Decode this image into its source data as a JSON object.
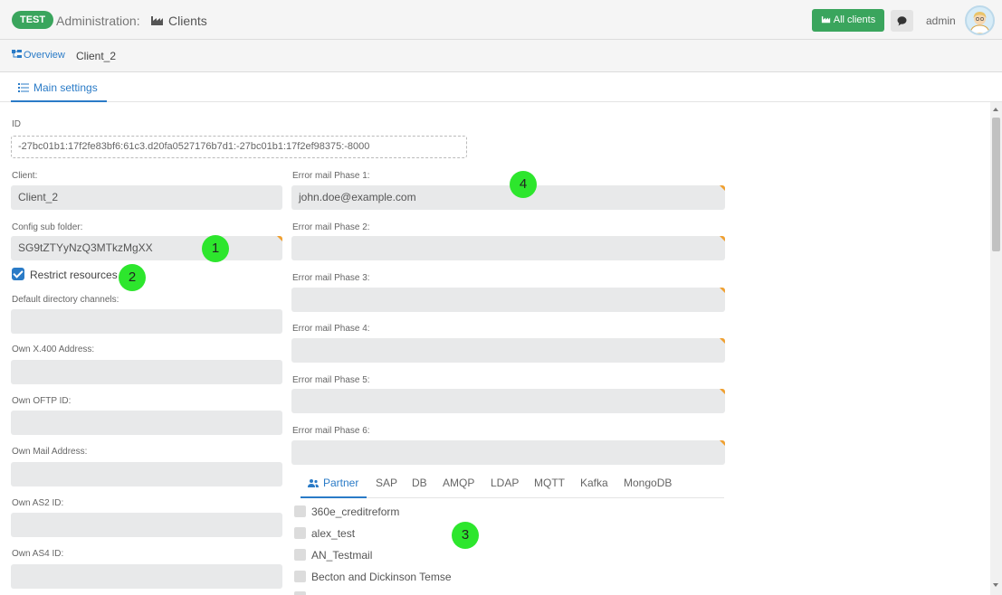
{
  "header": {
    "env_badge": "TEST",
    "title": "Administration:",
    "section": "Clients",
    "all_clients_label": "All clients",
    "user": "admin"
  },
  "breadcrumb": {
    "overview": "Overview",
    "current": "Client_2"
  },
  "tabs": {
    "main_settings": "Main settings"
  },
  "form": {
    "id_label": "ID",
    "id_value": "-27bc01b1:17f2fe83bf6:61c3.d20fa0527176b7d1:-27bc01b1:17f2ef98375:-8000",
    "client_label": "Client:",
    "client_value": "Client_2",
    "config_sub_folder_label": "Config sub folder:",
    "config_sub_folder_value": "SG9tZTYyNzQ3MTkzMgXX",
    "restrict_resources_label": "Restrict resources",
    "restrict_resources_checked": true,
    "default_directory_channels_label": "Default directory channels:",
    "own_x400_label": "Own X.400 Address:",
    "own_oftp_label": "Own OFTP ID:",
    "own_mail_label": "Own Mail Address:",
    "own_as2_label": "Own AS2 ID:",
    "own_as4_label": "Own AS4 ID:",
    "error_mail_1_label": "Error mail Phase 1:",
    "error_mail_1_value": "john.doe@example.com",
    "error_mail_2_label": "Error mail Phase 2:",
    "error_mail_3_label": "Error mail Phase 3:",
    "error_mail_4_label": "Error mail Phase 4:",
    "error_mail_5_label": "Error mail Phase 5:",
    "error_mail_6_label": "Error mail Phase 6:"
  },
  "resource_tabs": [
    "Partner",
    "SAP",
    "DB",
    "AMQP",
    "LDAP",
    "MQTT",
    "Kafka",
    "MongoDB"
  ],
  "partners": [
    "360e_creditreform",
    "alex_test",
    "AN_Testmail",
    "Becton and Dickinson Temse"
  ],
  "markers": [
    "1",
    "2",
    "3",
    "4"
  ],
  "colors": {
    "accent_green": "#3aa55d",
    "link_blue": "#2a7bc7",
    "required_corner": "#f0a030",
    "marker_green": "#2de62d"
  }
}
